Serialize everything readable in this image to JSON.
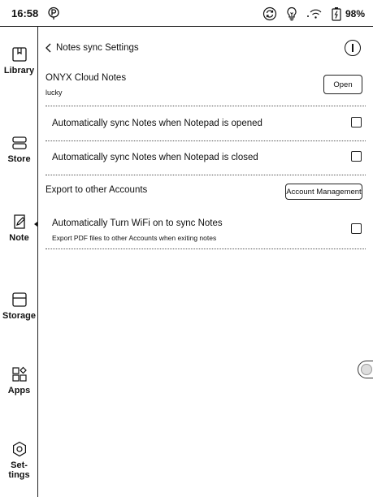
{
  "status_bar": {
    "time": "16:58",
    "battery": "98%",
    "icons": [
      "p-pin-icon",
      "sync-icon",
      "bulb-icon",
      "wifi-icon",
      "battery-icon"
    ]
  },
  "sidebar": {
    "items": [
      {
        "label": "Library",
        "icon": "bookmark-book-icon",
        "active": false
      },
      {
        "label": "Store",
        "icon": "store-icon",
        "active": false
      },
      {
        "label": "Note",
        "icon": "note-pen-icon",
        "active": true
      },
      {
        "label": "Storage",
        "icon": "storage-icon",
        "active": false
      },
      {
        "label": "Apps",
        "icon": "apps-grid-icon",
        "active": false
      },
      {
        "label": "Set-\ntings",
        "icon": "settings-hex-icon",
        "active": false
      }
    ]
  },
  "header": {
    "back_icon": "chevron-left-icon",
    "title": "Notes sync Settings",
    "info_icon": "info-icon"
  },
  "cloud": {
    "title": "ONYX Cloud Notes",
    "user": "lucky",
    "open_label": "Open"
  },
  "options": {
    "sync_opened": {
      "label": "Automatically sync Notes when Notepad is opened",
      "checked": false
    },
    "sync_closed": {
      "label": "Automatically sync Notes when Notepad is closed",
      "checked": false
    }
  },
  "export": {
    "title": "Export to other Accounts",
    "account_button": "Account Management",
    "wifi": {
      "label": "Automatically Turn WiFi on to sync Notes",
      "sub": "Export PDF files to other Accounts when exiting notes",
      "checked": false
    }
  }
}
